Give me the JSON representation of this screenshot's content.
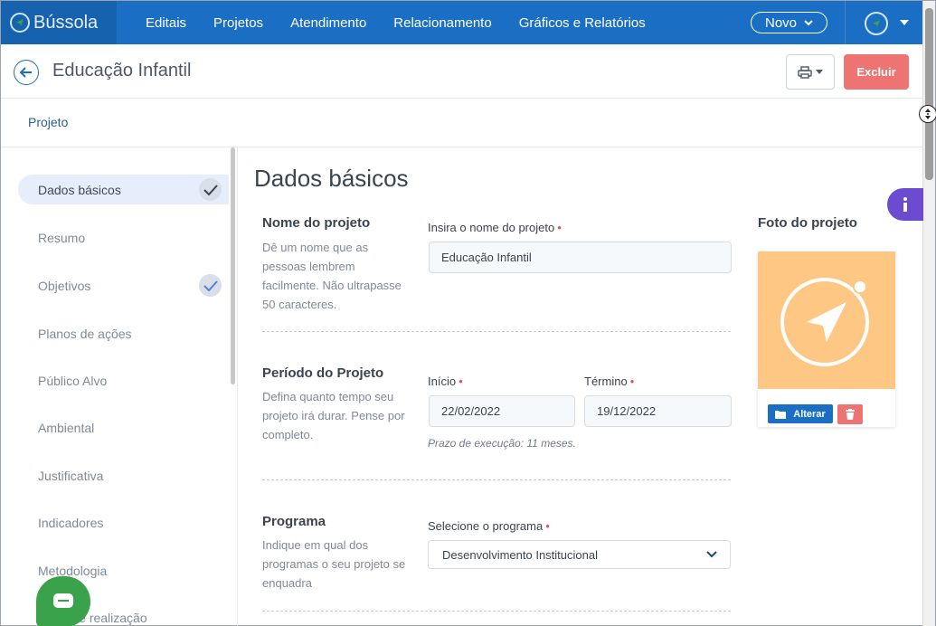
{
  "brand": {
    "name": "Bússola"
  },
  "nav": {
    "items": [
      "Editais",
      "Projetos",
      "Atendimento",
      "Relacionamento",
      "Gráficos e Relatórios"
    ],
    "novo_label": "Novo"
  },
  "header": {
    "title": "Educação Infantil",
    "delete_label": "Excluir"
  },
  "breadcrumb": {
    "label": "Projeto"
  },
  "sidebar": {
    "items": [
      {
        "label": "Dados básicos",
        "active": true,
        "done": true
      },
      {
        "label": "Resumo"
      },
      {
        "label": "Objetivos",
        "done": true
      },
      {
        "label": "Planos de ações"
      },
      {
        "label": "Público Alvo"
      },
      {
        "label": "Ambiental"
      },
      {
        "label": "Justificativa"
      },
      {
        "label": "Indicadores"
      },
      {
        "label": "Metodologia"
      },
      {
        "label": "Local de realização"
      }
    ]
  },
  "main": {
    "title": "Dados básicos",
    "nome": {
      "title": "Nome do projeto",
      "desc": "Dê um nome que as pessoas lembrem facilmente. Não ultrapasse 50 caracteres.",
      "label": "Insira o nome do projeto",
      "value": "Educação Infantil"
    },
    "periodo": {
      "title": "Período do Projeto",
      "desc": "Defina quanto tempo seu projeto irá durar. Pense por completo.",
      "inicio_label": "Início",
      "inicio_value": "22/02/2022",
      "termino_label": "Término",
      "termino_value": "19/12/2022",
      "hint": "Prazo de execução: 11 meses."
    },
    "programa": {
      "title": "Programa",
      "desc": "Indique em qual dos programas o seu projeto se enquadra",
      "label": "Selecione o programa",
      "value": "Desenvolvimento Institucional"
    }
  },
  "photo": {
    "title": "Foto do projeto",
    "alterar_label": "Alterar"
  },
  "colors": {
    "primary": "#1a6fc4",
    "danger": "#ee7474",
    "photo_bg": "#fec884",
    "info": "#6c4bd0",
    "chat": "#3aa24a"
  }
}
